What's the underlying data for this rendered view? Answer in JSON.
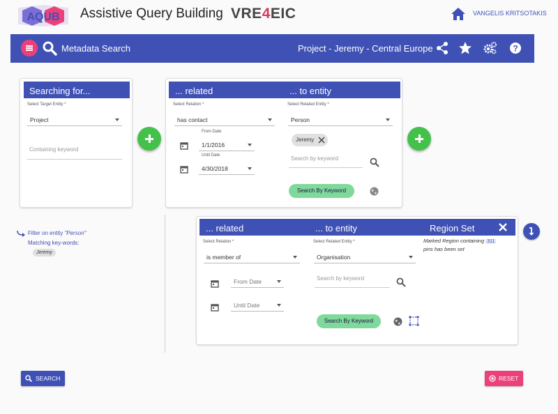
{
  "header": {
    "app_title": "Assistive Query Building",
    "brand_prefix": "VRE",
    "brand_four": "4",
    "brand_suffix": "EIC",
    "username": "VANGELIS KRITSOTAKIS",
    "logo_text": "AQUB",
    "home_icon": "home-icon"
  },
  "toolbar": {
    "title": "Metadata Search",
    "project": "Project - Jeremy - Central Europe",
    "icons": [
      "share-icon",
      "star-icon",
      "settings-icon",
      "help-icon"
    ]
  },
  "card_searching": {
    "header": "Searching for...",
    "target_label": "Select Target Entity *",
    "target_value": "Project",
    "keyword_placeholder": "Containing keyword"
  },
  "card_related1": {
    "header_related": "... related",
    "header_entity": "... to entity",
    "relation_label": "Select Relation *",
    "relation_value": "has contact",
    "entity_label": "Select Related Entity *",
    "entity_value": "Person",
    "from_label": "From Date",
    "from_value": "1/1/2016",
    "until_label": "Until Date",
    "until_value": "4/30/2018",
    "chip": "Jeremy",
    "keyword_placeholder": "Search by keyword",
    "search_button": "Search By Keyword"
  },
  "filter": {
    "prefix": "Filter on entity ",
    "entity": "\"Person\"",
    "matching_label": "Matching key-words:",
    "chip": "Jeremy"
  },
  "card_related2": {
    "header_related": "... related",
    "header_entity": "... to entity",
    "header_region": "Region Set",
    "relation_label": "Select Relation *",
    "relation_value": "is member of",
    "entity_label": "Select Related Entity *",
    "entity_value": "Organisation",
    "from_placeholder": "From Date",
    "until_placeholder": "Until Date",
    "keyword_placeholder": "Search by keyword",
    "search_button": "Search By Keyword",
    "region_text_1": "Marked Region containing",
    "region_count": "311",
    "region_text_2": "pins has been set"
  },
  "buttons": {
    "search": "SEARCH",
    "reset": "RESET"
  },
  "colors": {
    "primary": "#3f51b5",
    "accent": "#ec407a",
    "fab": "#43c14b",
    "keyword_button": "#7ed99a"
  }
}
